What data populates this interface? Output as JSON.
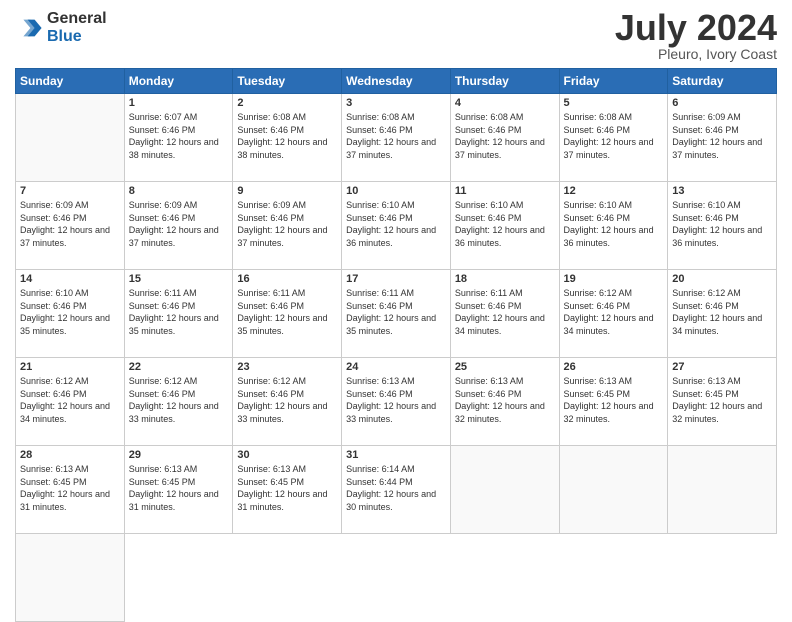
{
  "logo": {
    "general": "General",
    "blue": "Blue"
  },
  "title": {
    "month": "July 2024",
    "location": "Pleuro, Ivory Coast"
  },
  "weekdays": [
    "Sunday",
    "Monday",
    "Tuesday",
    "Wednesday",
    "Thursday",
    "Friday",
    "Saturday"
  ],
  "days": [
    {
      "date": null,
      "number": "",
      "sunrise": "",
      "sunset": "",
      "daylight": ""
    },
    {
      "date": 1,
      "number": "1",
      "sunrise": "6:07 AM",
      "sunset": "6:46 PM",
      "daylight": "12 hours and 38 minutes."
    },
    {
      "date": 2,
      "number": "2",
      "sunrise": "6:08 AM",
      "sunset": "6:46 PM",
      "daylight": "12 hours and 38 minutes."
    },
    {
      "date": 3,
      "number": "3",
      "sunrise": "6:08 AM",
      "sunset": "6:46 PM",
      "daylight": "12 hours and 37 minutes."
    },
    {
      "date": 4,
      "number": "4",
      "sunrise": "6:08 AM",
      "sunset": "6:46 PM",
      "daylight": "12 hours and 37 minutes."
    },
    {
      "date": 5,
      "number": "5",
      "sunrise": "6:08 AM",
      "sunset": "6:46 PM",
      "daylight": "12 hours and 37 minutes."
    },
    {
      "date": 6,
      "number": "6",
      "sunrise": "6:09 AM",
      "sunset": "6:46 PM",
      "daylight": "12 hours and 37 minutes."
    },
    {
      "date": 7,
      "number": "7",
      "sunrise": "6:09 AM",
      "sunset": "6:46 PM",
      "daylight": "12 hours and 37 minutes."
    },
    {
      "date": 8,
      "number": "8",
      "sunrise": "6:09 AM",
      "sunset": "6:46 PM",
      "daylight": "12 hours and 37 minutes."
    },
    {
      "date": 9,
      "number": "9",
      "sunrise": "6:09 AM",
      "sunset": "6:46 PM",
      "daylight": "12 hours and 37 minutes."
    },
    {
      "date": 10,
      "number": "10",
      "sunrise": "6:10 AM",
      "sunset": "6:46 PM",
      "daylight": "12 hours and 36 minutes."
    },
    {
      "date": 11,
      "number": "11",
      "sunrise": "6:10 AM",
      "sunset": "6:46 PM",
      "daylight": "12 hours and 36 minutes."
    },
    {
      "date": 12,
      "number": "12",
      "sunrise": "6:10 AM",
      "sunset": "6:46 PM",
      "daylight": "12 hours and 36 minutes."
    },
    {
      "date": 13,
      "number": "13",
      "sunrise": "6:10 AM",
      "sunset": "6:46 PM",
      "daylight": "12 hours and 36 minutes."
    },
    {
      "date": 14,
      "number": "14",
      "sunrise": "6:10 AM",
      "sunset": "6:46 PM",
      "daylight": "12 hours and 35 minutes."
    },
    {
      "date": 15,
      "number": "15",
      "sunrise": "6:11 AM",
      "sunset": "6:46 PM",
      "daylight": "12 hours and 35 minutes."
    },
    {
      "date": 16,
      "number": "16",
      "sunrise": "6:11 AM",
      "sunset": "6:46 PM",
      "daylight": "12 hours and 35 minutes."
    },
    {
      "date": 17,
      "number": "17",
      "sunrise": "6:11 AM",
      "sunset": "6:46 PM",
      "daylight": "12 hours and 35 minutes."
    },
    {
      "date": 18,
      "number": "18",
      "sunrise": "6:11 AM",
      "sunset": "6:46 PM",
      "daylight": "12 hours and 34 minutes."
    },
    {
      "date": 19,
      "number": "19",
      "sunrise": "6:12 AM",
      "sunset": "6:46 PM",
      "daylight": "12 hours and 34 minutes."
    },
    {
      "date": 20,
      "number": "20",
      "sunrise": "6:12 AM",
      "sunset": "6:46 PM",
      "daylight": "12 hours and 34 minutes."
    },
    {
      "date": 21,
      "number": "21",
      "sunrise": "6:12 AM",
      "sunset": "6:46 PM",
      "daylight": "12 hours and 34 minutes."
    },
    {
      "date": 22,
      "number": "22",
      "sunrise": "6:12 AM",
      "sunset": "6:46 PM",
      "daylight": "12 hours and 33 minutes."
    },
    {
      "date": 23,
      "number": "23",
      "sunrise": "6:12 AM",
      "sunset": "6:46 PM",
      "daylight": "12 hours and 33 minutes."
    },
    {
      "date": 24,
      "number": "24",
      "sunrise": "6:13 AM",
      "sunset": "6:46 PM",
      "daylight": "12 hours and 33 minutes."
    },
    {
      "date": 25,
      "number": "25",
      "sunrise": "6:13 AM",
      "sunset": "6:46 PM",
      "daylight": "12 hours and 32 minutes."
    },
    {
      "date": 26,
      "number": "26",
      "sunrise": "6:13 AM",
      "sunset": "6:45 PM",
      "daylight": "12 hours and 32 minutes."
    },
    {
      "date": 27,
      "number": "27",
      "sunrise": "6:13 AM",
      "sunset": "6:45 PM",
      "daylight": "12 hours and 32 minutes."
    },
    {
      "date": 28,
      "number": "28",
      "sunrise": "6:13 AM",
      "sunset": "6:45 PM",
      "daylight": "12 hours and 31 minutes."
    },
    {
      "date": 29,
      "number": "29",
      "sunrise": "6:13 AM",
      "sunset": "6:45 PM",
      "daylight": "12 hours and 31 minutes."
    },
    {
      "date": 30,
      "number": "30",
      "sunrise": "6:13 AM",
      "sunset": "6:45 PM",
      "daylight": "12 hours and 31 minutes."
    },
    {
      "date": 31,
      "number": "31",
      "sunrise": "6:14 AM",
      "sunset": "6:44 PM",
      "daylight": "12 hours and 30 minutes."
    },
    {
      "date": null,
      "number": "",
      "sunrise": "",
      "sunset": "",
      "daylight": ""
    },
    {
      "date": null,
      "number": "",
      "sunrise": "",
      "sunset": "",
      "daylight": ""
    },
    {
      "date": null,
      "number": "",
      "sunrise": "",
      "sunset": "",
      "daylight": ""
    },
    {
      "date": null,
      "number": "",
      "sunrise": "",
      "sunset": "",
      "daylight": ""
    }
  ]
}
